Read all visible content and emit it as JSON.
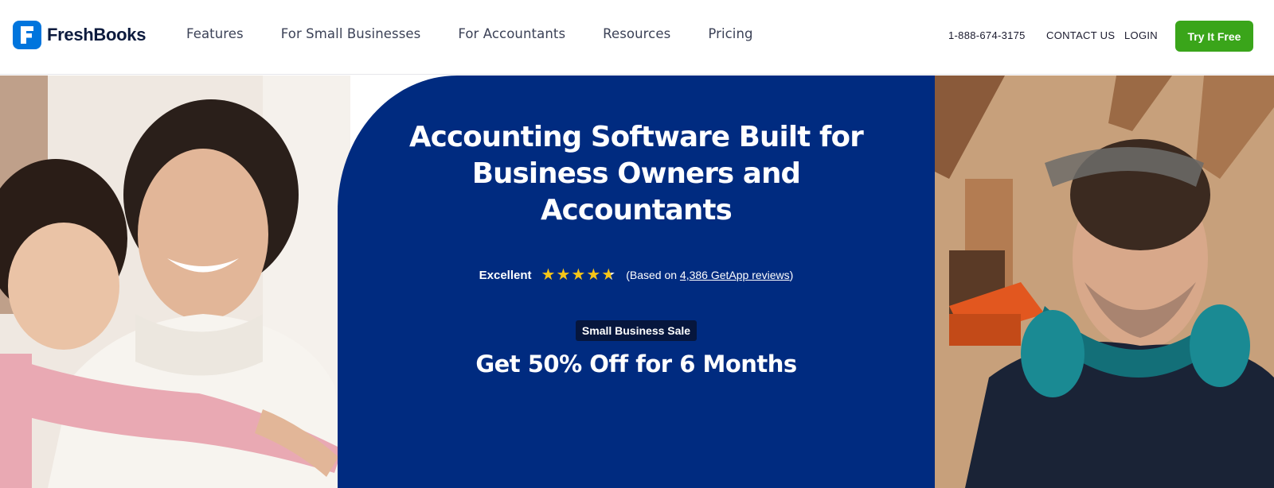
{
  "header": {
    "logo_text": "FreshBooks",
    "logo_icon": "freshbooks-logo-icon",
    "nav": [
      {
        "label": "Features"
      },
      {
        "label": "For Small Businesses"
      },
      {
        "label": "For Accountants"
      },
      {
        "label": "Resources"
      },
      {
        "label": "Pricing"
      }
    ],
    "phone": "1-888-674-3175",
    "contact_label": "CONTACT US",
    "login_label": "LOGIN",
    "cta_label": "Try It Free"
  },
  "hero": {
    "headline_lines": [
      "Accounting Software Built for",
      "Business Owners and",
      "Accountants"
    ],
    "rating": {
      "label": "Excellent",
      "stars": 4.7,
      "prefix": "(Based on ",
      "link_text": "4,386 GetApp reviews",
      "suffix": ")"
    },
    "badge": "Small Business Sale",
    "offer": "Get 50% Off for 6 Months",
    "left_image": "mother-and-daughter-photo",
    "right_image": "man-with-safety-glasses-and-earmuffs-photo"
  },
  "colors": {
    "brand_blue": "#0075dd",
    "panel_navy": "#002b80",
    "cta_green": "#3aa51a",
    "star_gold": "#f5c518"
  }
}
